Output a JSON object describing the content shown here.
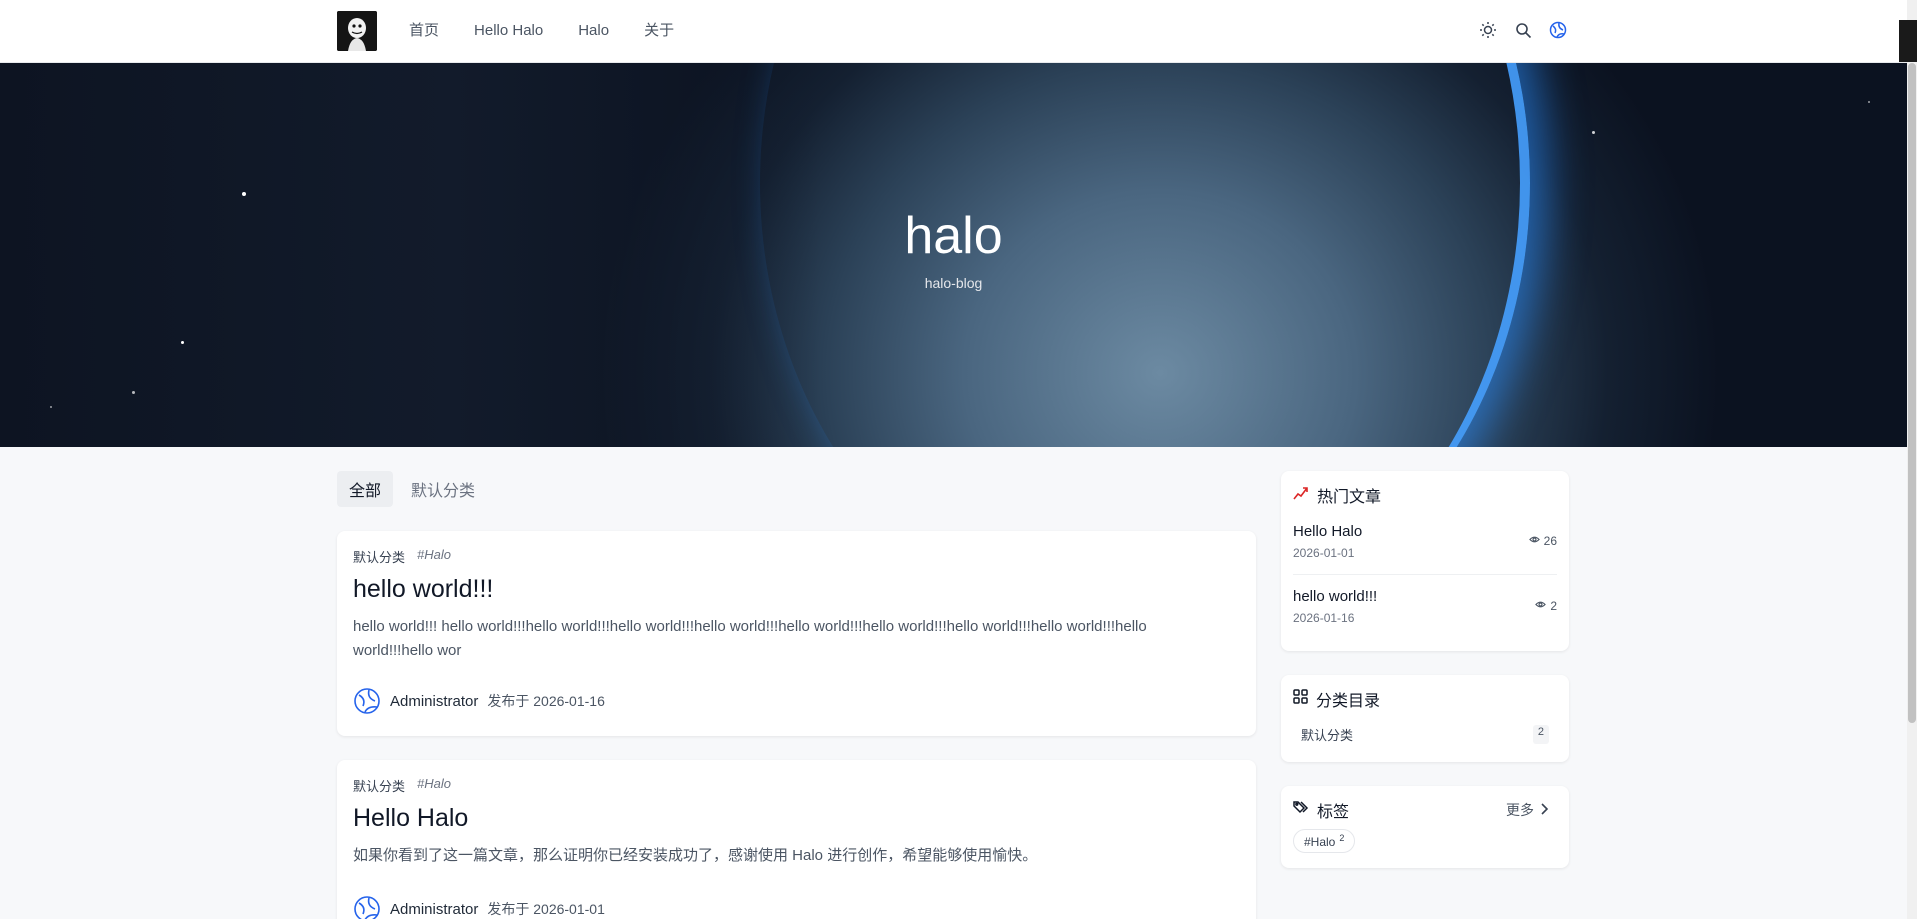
{
  "nav": {
    "items": [
      "首页",
      "Hello Halo",
      "Halo",
      "关于"
    ]
  },
  "hero": {
    "title": "halo",
    "subtitle": "halo-blog"
  },
  "tabs": [
    "全部",
    "默认分类"
  ],
  "posts": [
    {
      "category": "默认分类",
      "tag": "#Halo",
      "title": "hello world!!!",
      "excerpt": "hello world!!! hello world!!!hello world!!!hello world!!!hello world!!!hello world!!!hello world!!!hello world!!!hello world!!!hello world!!!hello wor",
      "author": "Administrator",
      "published": "发布于 2026-01-16"
    },
    {
      "category": "默认分类",
      "tag": "#Halo",
      "title": "Hello Halo",
      "excerpt": "如果你看到了这一篇文章，那么证明你已经安装成功了，感谢使用 Halo 进行创作，希望能够使用愉快。",
      "author": "Administrator",
      "published": "发布于 2026-01-01"
    }
  ],
  "sidebar": {
    "hot": {
      "title": "热门文章",
      "items": [
        {
          "title": "Hello Halo",
          "date": "2026-01-01",
          "views": "26"
        },
        {
          "title": "hello world!!!",
          "date": "2026-01-16",
          "views": "2"
        }
      ]
    },
    "categories": {
      "title": "分类目录",
      "items": [
        {
          "name": "默认分类",
          "count": "2"
        }
      ]
    },
    "tags": {
      "title": "标签",
      "more": "更多",
      "items": [
        {
          "name": "#Halo",
          "count": "2"
        }
      ]
    }
  },
  "colors": {
    "accent": "#2563eb",
    "hot_icon": "#dc2626"
  }
}
